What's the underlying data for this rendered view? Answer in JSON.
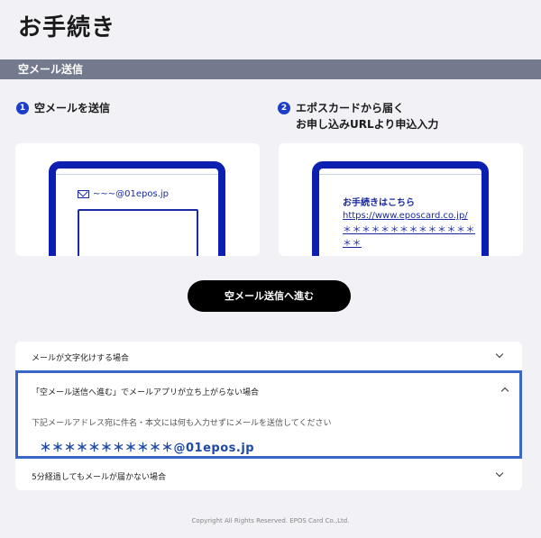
{
  "page": {
    "title": "お手続き"
  },
  "section": {
    "title": "空メール送信"
  },
  "steps": [
    {
      "num": "1",
      "line1": "空メールを送信",
      "line2": ""
    },
    {
      "num": "2",
      "line1": "エポスカードから届く",
      "line2": "お申し込みURLより申込入力"
    }
  ],
  "illustration1": {
    "email": "~~~@01epos.jp"
  },
  "illustration2": {
    "title": "お手続きはこちら",
    "url": "https://www.eposcard.co.jp/",
    "stars": "＊＊＊＊＊＊＊＊＊＊＊＊＊＊＊＊"
  },
  "cta": {
    "label": "空メール送信へ進む"
  },
  "faq": {
    "items": [
      {
        "label": "メールが文字化けする場合",
        "expanded": false
      },
      {
        "label": "「空メール送信へ進む」でメールアプリが立ち上がらない場合",
        "expanded": true,
        "description": "下記メールアドレス宛に件名・本文には何も入力せずにメールを送信してください",
        "email": "＊＊＊＊＊＊＊＊＊＊＊@01epos.jp"
      },
      {
        "label": "5分経過してもメールが届かない場合",
        "expanded": false
      }
    ]
  },
  "footer": {
    "copyright": "Copyright All Rights Reserved. EPOS Card Co.,Ltd."
  },
  "colors": {
    "accent": "#0b1fb0",
    "section_bar": "#747a8e",
    "cta": "#000000",
    "highlight_border": "#3a66c8"
  }
}
